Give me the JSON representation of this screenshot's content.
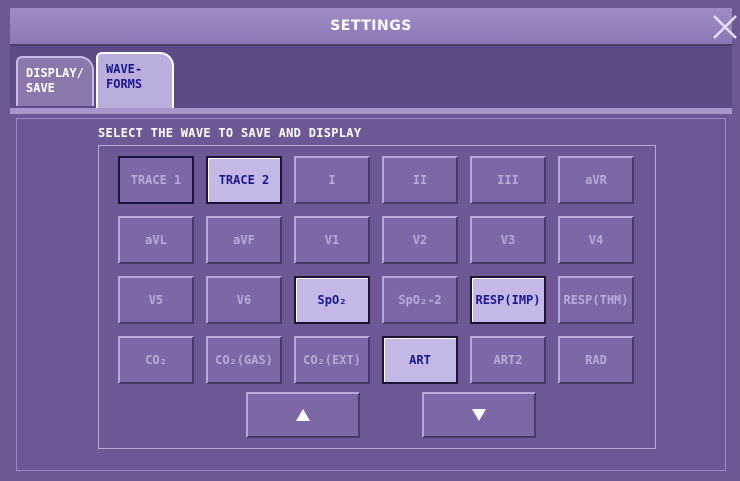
{
  "window": {
    "title": "SETTINGS"
  },
  "tabs": [
    {
      "line1": "DISPLAY/",
      "line2": "SAVE"
    },
    {
      "line1": "WAVE-",
      "line2": "FORMS"
    }
  ],
  "instruction": "SELECT THE WAVE TO SAVE AND DISPLAY",
  "wave_buttons": [
    {
      "label": "TRACE 1",
      "state": "outlined"
    },
    {
      "label": "TRACE 2",
      "state": "selected"
    },
    {
      "label": "I",
      "state": "normal"
    },
    {
      "label": "II",
      "state": "normal"
    },
    {
      "label": "III",
      "state": "normal"
    },
    {
      "label": "aVR",
      "state": "normal"
    },
    {
      "label": "aVL",
      "state": "normal"
    },
    {
      "label": "aVF",
      "state": "normal"
    },
    {
      "label": "V1",
      "state": "normal"
    },
    {
      "label": "V2",
      "state": "normal"
    },
    {
      "label": "V3",
      "state": "normal"
    },
    {
      "label": "V4",
      "state": "normal"
    },
    {
      "label": "V5",
      "state": "normal"
    },
    {
      "label": "V6",
      "state": "normal"
    },
    {
      "label": "SpO₂",
      "state": "selected"
    },
    {
      "label": "SpO₂-2",
      "state": "normal"
    },
    {
      "label": "RESP(IMP)",
      "state": "selected"
    },
    {
      "label": "RESP(THM)",
      "state": "normal"
    },
    {
      "label": "CO₂",
      "state": "normal"
    },
    {
      "label": "CO₂(GAS)",
      "state": "normal"
    },
    {
      "label": "CO₂(EXT)",
      "state": "normal"
    },
    {
      "label": "ART",
      "state": "selected"
    },
    {
      "label": "ART2",
      "state": "normal"
    },
    {
      "label": "RAD",
      "state": "normal"
    }
  ],
  "scroll": {
    "up_icon": "triangle-up",
    "down_icon": "triangle-down"
  },
  "colors": {
    "background": "#6e5894",
    "selected_fill": "#c3b8e6",
    "selected_text": "#1a1a8e",
    "normal_text": "#b9a9d8"
  }
}
